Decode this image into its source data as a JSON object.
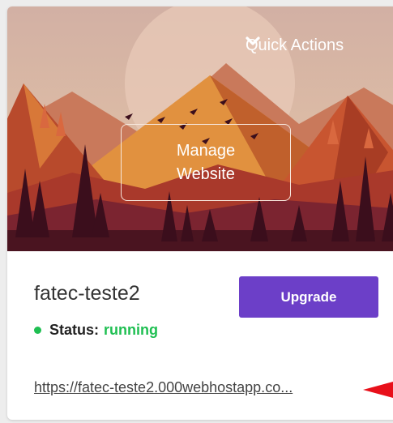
{
  "hero": {
    "quick_actions_label": "Quick Actions",
    "manage_label": "Manage Website"
  },
  "site": {
    "name": "fatec-teste2",
    "upgrade_label": "Upgrade",
    "status_label": "Status:",
    "status_value": "running",
    "url": "https://fatec-teste2.000webhostapp.co..."
  },
  "colors": {
    "accent": "#6c3fc8",
    "status_running": "#1fbf52",
    "pointer_arrow": "#e8101a"
  }
}
